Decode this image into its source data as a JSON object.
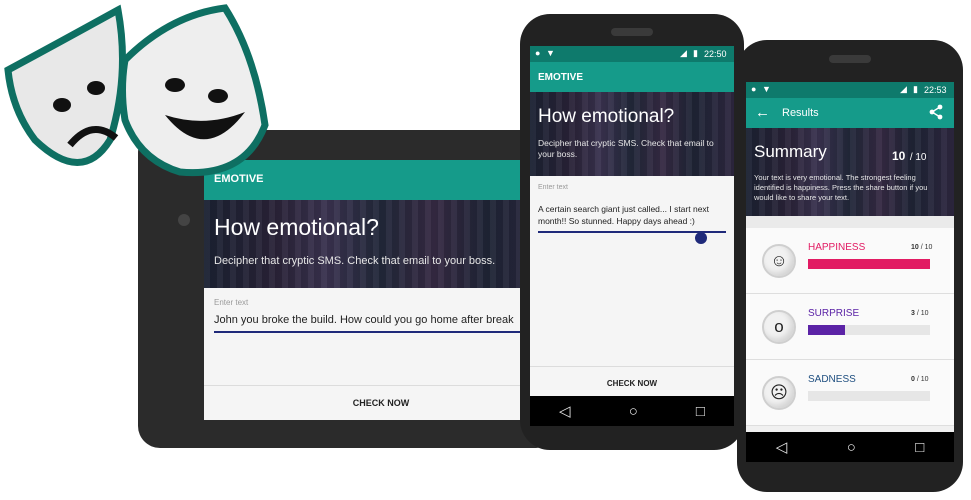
{
  "logo": {
    "name": "theatre-masks-logo"
  },
  "tablet": {
    "app_title": "EMOTIVE",
    "hero_title": "How emotional?",
    "hero_subtitle": "Decipher that cryptic SMS. Check that email to your boss.",
    "field_label": "Enter text",
    "field_value": "John you broke the build. How could you go home after break",
    "check_button": "CHECK NOW"
  },
  "phone1": {
    "status_time": "22:50",
    "app_title": "EMOTIVE",
    "hero_title": "How emotional?",
    "hero_subtitle": "Decipher that cryptic SMS. Check that email to your boss.",
    "field_label": "Enter text",
    "field_value": "A certain search giant just called... I start next month!! So stunned. Happy days ahead :)",
    "check_button": "CHECK NOW"
  },
  "phone2": {
    "status_time": "22:53",
    "toolbar_title": "Results",
    "summary_title": "Summary",
    "score": "10",
    "score_max": "/ 10",
    "summary_text": "Your text is very emotional. The strongest feeling identified is happiness. Press the share button if you would like to share your text.",
    "results": [
      {
        "label": "HAPPINESS",
        "score": "10",
        "max": "/ 10",
        "fraction": 1.0,
        "color": "#e21b63",
        "face": "☺"
      },
      {
        "label": "SURPRISE",
        "score": "3",
        "max": "/ 10",
        "fraction": 0.3,
        "color": "#5b23a6",
        "face": "o"
      },
      {
        "label": "SADNESS",
        "score": "0",
        "max": "/ 10",
        "fraction": 0.0,
        "color": "#1f4f80",
        "face": "☹"
      }
    ]
  },
  "colors": {
    "accent": "#159b8a",
    "accent_dark": "#0e7a6c",
    "happiness": "#e21b63",
    "surprise": "#5b23a6",
    "sadness": "#1f4f80"
  },
  "nav": {
    "back": "◁",
    "home": "○",
    "recent": "□"
  }
}
